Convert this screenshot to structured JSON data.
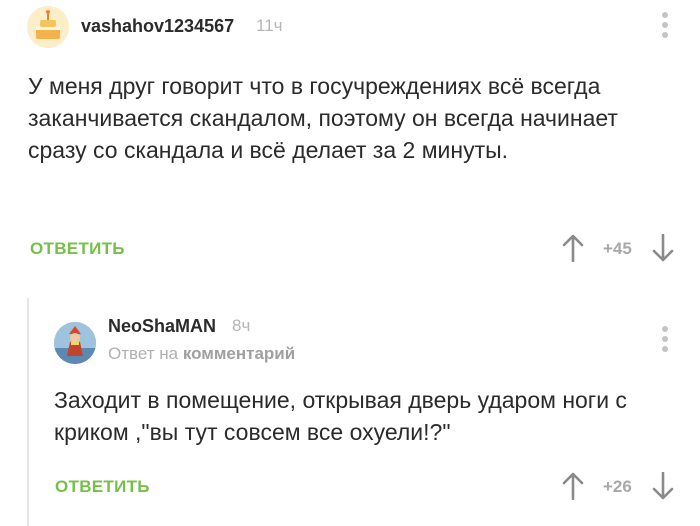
{
  "comment1": {
    "username": "vashahov1234567",
    "time": "11ч",
    "text": "У меня друг говорит что в госучреждениях всё всегда заканчивается скандалом, поэтому он всегда начинает сразу со скандала и всё делает за 2 минуты.",
    "reply_label": "ОТВЕТИТЬ",
    "rating": "+45"
  },
  "comment2": {
    "username": "NeoShaMAN",
    "time": "8ч",
    "reply_to_prefix": "Ответ на",
    "reply_to_target": "комментарий",
    "text": "Заходит в помещение, открывая дверь ударом ноги с криком ,\"вы тут совсем все охуели!?\"",
    "reply_label": "ОТВЕТИТЬ",
    "rating": "+26"
  },
  "icons": {
    "menu": "more-vertical-icon",
    "upvote": "arrow-up-icon",
    "downvote": "arrow-down-icon"
  },
  "colors": {
    "accent_green": "#76c04a",
    "muted": "#b5b5b5",
    "text": "#2b2b2b"
  }
}
